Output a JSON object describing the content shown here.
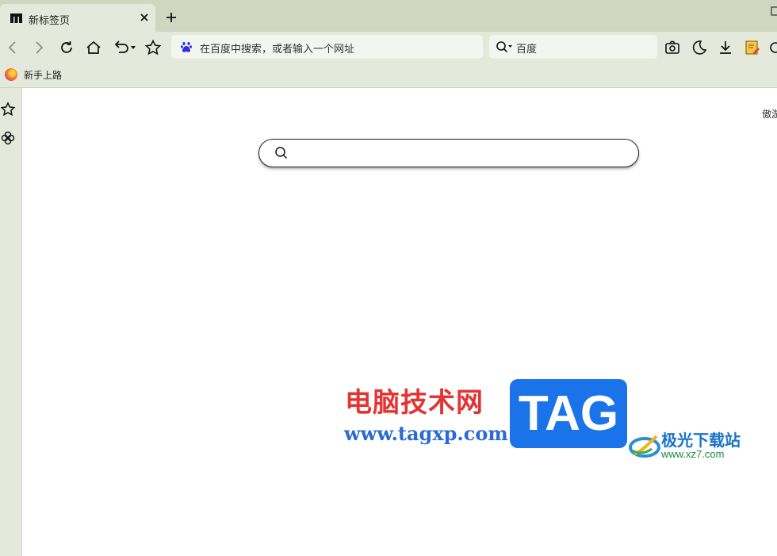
{
  "tab": {
    "title": "新标签页"
  },
  "toolbar": {
    "address_placeholder": "在百度中搜索，或者输入一个网址",
    "search_engine": "百度"
  },
  "bookmarks": [
    {
      "label": "新手上路",
      "icon": "firefox-icon"
    }
  ],
  "content": {
    "corner_text": "傲游"
  },
  "watermark": {
    "site_cn": "电脑技术网",
    "site_url": "www.tagxp.com",
    "badge": "TAG",
    "site2_name": "极光下载站",
    "site2_url": "www.xz7.com"
  },
  "colors": {
    "tabstrip": "#cfd7c0",
    "toolbar": "#e4e9dc",
    "watermark_red": "#e53333",
    "watermark_blue": "#1a73e8"
  }
}
